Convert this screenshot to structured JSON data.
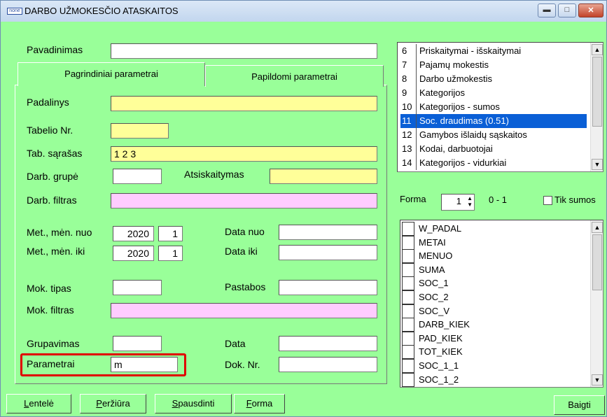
{
  "window": {
    "app_icon_text": "none",
    "title": "DARBO UŽMOKESČIO ATASKAITOS",
    "min_glyph": "▬",
    "max_glyph": "□",
    "close_glyph": "✕"
  },
  "form": {
    "pavadinimas_label": "Pavadinimas",
    "pavadinimas_value": "",
    "tabs": [
      "Pagrindiniai parametrai",
      "Papildomi parametrai"
    ],
    "padalinys_label": "Padalinys",
    "padalinys_value": "",
    "tabelio_label": "Tabelio Nr.",
    "tabelio_value": "",
    "tab_sarasas_label": "Tab. sąrašas",
    "tab_sarasas_value": "1 2 3",
    "darb_grupe_label": "Darb. grupė",
    "darb_grupe_value": "",
    "atsiskaitymas_label": "Atsiskaitymas",
    "atsiskaitymas_value": "",
    "darb_filtras_label": "Darb. filtras",
    "darb_filtras_value": "",
    "met_men_nuo_label": "Met., mėn. nuo",
    "met_nuo": "2020",
    "men_nuo": "1",
    "data_nuo_label": "Data nuo",
    "data_nuo_value": "",
    "met_men_iki_label": "Met., mėn. iki",
    "met_iki": "2020",
    "men_iki": "1",
    "data_iki_label": "Data iki",
    "data_iki_value": "",
    "mok_tipas_label": "Mok. tipas",
    "mok_tipas_value": "",
    "pastabos_label": "Pastabos",
    "pastabos_value": "",
    "mok_filtras_label": "Mok. filtras",
    "mok_filtras_value": "",
    "grupavimas_label": "Grupavimas",
    "grupavimas_value": "",
    "data_label": "Data",
    "data_value": "",
    "parametrai_label": "Parametrai",
    "parametrai_value": "m",
    "dok_nr_label": "Dok. Nr.",
    "dok_nr_value": ""
  },
  "reports": [
    {
      "num": "6",
      "name": "Priskaitymai - išskaitymai"
    },
    {
      "num": "7",
      "name": "Pajamų mokestis"
    },
    {
      "num": "8",
      "name": "Darbo užmokestis"
    },
    {
      "num": "9",
      "name": "Kategorijos"
    },
    {
      "num": "10",
      "name": "Kategorijos - sumos"
    },
    {
      "num": "11",
      "name": "Soc. draudimas (0.51)",
      "selected": true
    },
    {
      "num": "12",
      "name": "Gamybos išlaidų sąskaitos"
    },
    {
      "num": "13",
      "name": "Kodai, darbuotojai"
    },
    {
      "num": "14",
      "name": "Kategorijos - vidurkiai"
    }
  ],
  "forma": {
    "label": "Forma",
    "value": "1",
    "range": "0 - 1",
    "tik_sumos_label": "Tik sumos"
  },
  "columns": [
    "W_PADAL",
    "METAI",
    "MENUO",
    "SUMA",
    "SOC_1",
    "SOC_2",
    "SOC_V",
    "DARB_KIEK",
    "PAD_KIEK",
    "TOT_KIEK",
    "SOC_1_1",
    "SOC_1_2"
  ],
  "buttons": {
    "lentele": {
      "first": "L",
      "rest": "entelė"
    },
    "perziura": {
      "first": "P",
      "rest": "eržiūra"
    },
    "spausdinti": {
      "first": "S",
      "rest": "pausdinti"
    },
    "forma": {
      "first": "F",
      "rest": "orma"
    },
    "baigti": "Baigti"
  },
  "colors": {
    "background": "#99ff99",
    "yellow_field": "#ffff99",
    "pink_field": "#ffccff",
    "selection": "#0a5fd6",
    "highlight": "#e00000"
  }
}
